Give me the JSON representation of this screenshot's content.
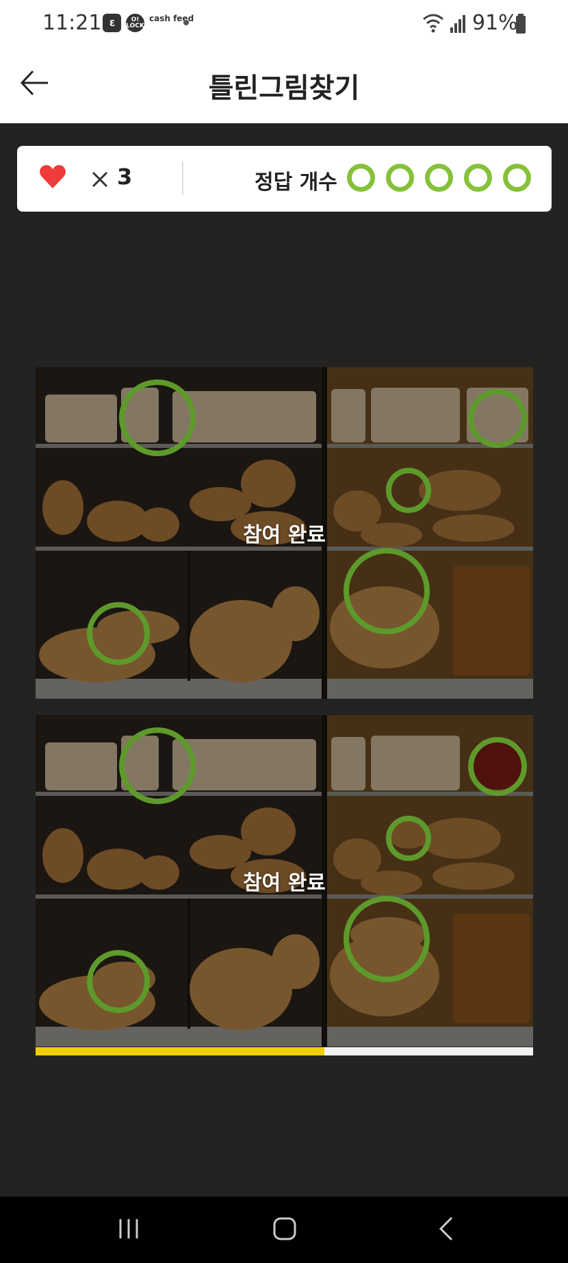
{
  "status_bar": {
    "time": "11:21",
    "app_icon_1": "ℇ",
    "app_icon_2": "O! LOCK",
    "app_icon_3": "cash feed",
    "battery": "91%"
  },
  "header": {
    "title": "틀린그림찾기",
    "back_icon": "arrow-left-icon"
  },
  "score": {
    "lives_icon": "heart-icon",
    "lives_symbol": "×",
    "lives_count": "3",
    "answer_label": "정답 개수",
    "answer_found": 5,
    "answer_total": 5,
    "accent_color": "#86c13a"
  },
  "puzzle": {
    "participation_text": "참여 완료",
    "marker_color": "#5e9a2b"
  },
  "timer": {
    "progress": 0.58,
    "fill_color": "#f0cf00"
  },
  "nav": {
    "recent_icon": "recent-apps-icon",
    "home_icon": "home-icon",
    "back_icon": "nav-back-icon"
  }
}
